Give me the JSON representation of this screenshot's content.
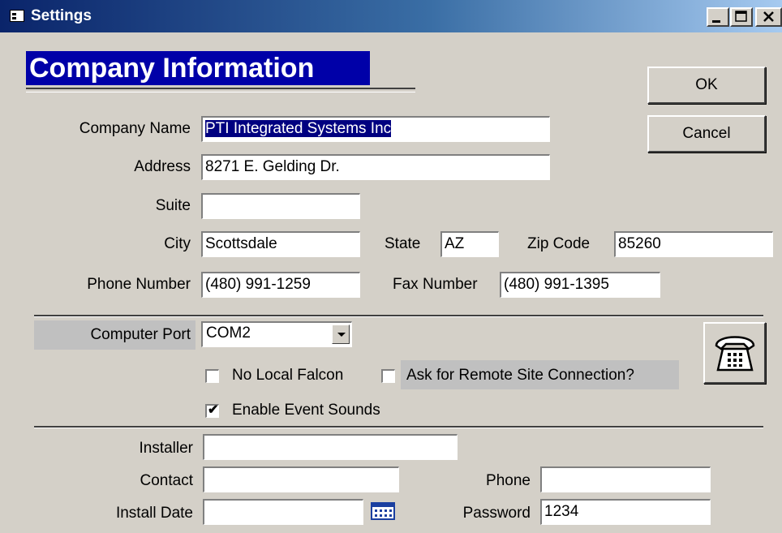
{
  "window": {
    "title": "Settings",
    "controls": {
      "minimize": "_",
      "maximize": "□",
      "close": "✕"
    }
  },
  "section_title": "Company Information",
  "buttons": {
    "ok": "OK",
    "cancel": "Cancel"
  },
  "company": {
    "name_label": "Company Name",
    "name_value": "PTI Integrated Systems Inc",
    "address_label": "Address",
    "address_value": "8271 E. Gelding Dr.",
    "suite_label": "Suite",
    "suite_value": "",
    "city_label": "City",
    "city_value": "Scottsdale",
    "state_label": "State",
    "state_value": "AZ",
    "zip_label": "Zip Code",
    "zip_value": "85260",
    "phone_label": "Phone Number",
    "phone_value": "(480) 991-1259",
    "fax_label": "Fax Number",
    "fax_value": "(480) 991-1395"
  },
  "port": {
    "label": "Computer Port",
    "selected": "COM2"
  },
  "options": {
    "no_local_falcon": {
      "label": "No Local Falcon",
      "checked": false
    },
    "ask_remote": {
      "label": "Ask for Remote Site Connection?",
      "checked": false
    },
    "event_sounds": {
      "label": "Enable Event Sounds",
      "checked": true,
      "mark": "✔"
    }
  },
  "installer": {
    "installer_label": "Installer",
    "installer_value": "",
    "contact_label": "Contact",
    "contact_value": "",
    "install_date_label": "Install Date",
    "install_date_value": "",
    "phone_label": "Phone",
    "phone_value": "",
    "password_label": "Password",
    "password_value": "1234"
  },
  "icons": {
    "phone": "telephone-icon",
    "calendar": "calendar-icon"
  }
}
